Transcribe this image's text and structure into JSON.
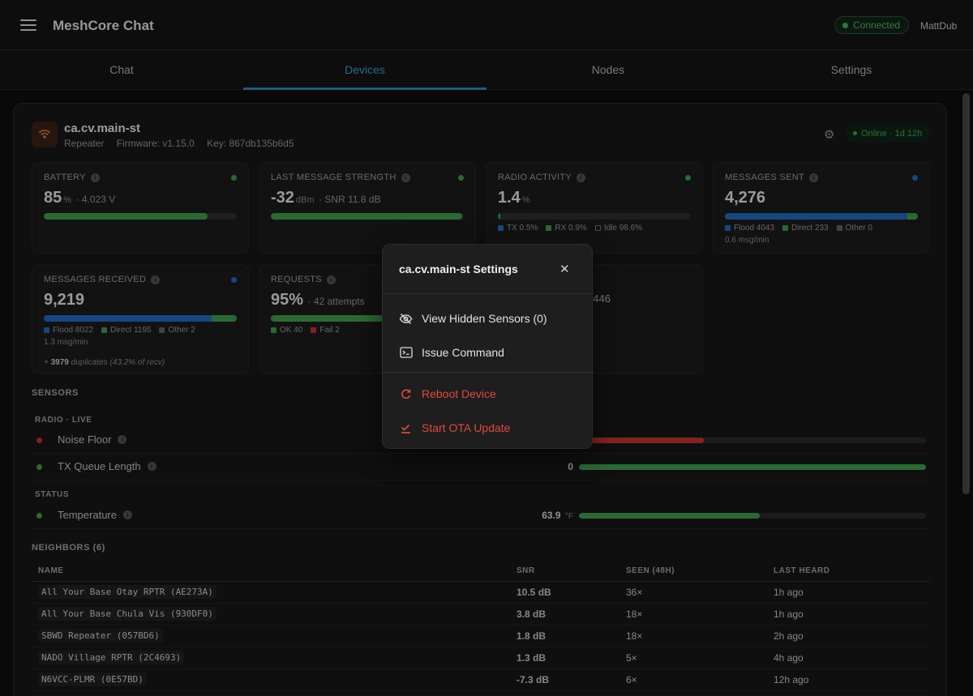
{
  "app": {
    "title": "MeshCore Chat",
    "user": "MattDub",
    "connection": "Connected"
  },
  "tabs": [
    {
      "label": "Chat"
    },
    {
      "label": "Devices"
    },
    {
      "label": "Nodes"
    },
    {
      "label": "Settings"
    }
  ],
  "device": {
    "name": "ca.cv.main-st",
    "role": "Repeater",
    "firmware": "Firmware: v1.15.0",
    "key": "Key: 867db135b6d5",
    "status": "Online · 1d 12h"
  },
  "cards": {
    "battery": {
      "label": "BATTERY",
      "value": "85",
      "unit": "%",
      "sub": "· 4.023 V",
      "level_pct": 85
    },
    "strength": {
      "label": "LAST MESSAGE STRENGTH",
      "value": "-32",
      "unit": "dBm",
      "sub": "· SNR 11.8 dB",
      "level_pct": 99
    },
    "radio": {
      "label": "RADIO ACTIVITY",
      "value": "1.4",
      "unit": "%",
      "tx": "TX 0.5%",
      "rx": "RX 0.9%",
      "idle": "Idle 98.6%",
      "tx_pct": 0.5,
      "rx_pct": 0.9
    },
    "sent": {
      "label": "MESSAGES SENT",
      "value": "4,276",
      "flood": "Flood 4043",
      "direct": "Direct 233",
      "other": "Other 0",
      "rate": "0.6 msg/min",
      "flood_n": 4043,
      "direct_n": 233,
      "other_n": 0
    },
    "received": {
      "label": "MESSAGES RECEIVED",
      "value": "9,219",
      "flood": "Flood 8022",
      "direct": "Direct 1195",
      "other": "Other 2",
      "rate": "1.3 msg/min",
      "dup_prefix": "+ ",
      "dup_count": "3979",
      "dup_suffix": " duplicates (43.2% of recv)",
      "flood_n": 8022,
      "direct_n": 1195,
      "other_n": 2
    },
    "requests": {
      "label": "REQUESTS",
      "value": "95%",
      "sub": "· 42 attempts",
      "ok": "OK 40",
      "fail": "Fail 2",
      "ok_n": 40,
      "fail_n": 2
    },
    "partial": {
      "text": "0446"
    }
  },
  "sensors": {
    "heading": "SENSORS",
    "radio_group": "RADIO · LIVE",
    "status_group": "STATUS",
    "rows": [
      {
        "name": "Noise Floor",
        "value": "",
        "unit": "",
        "level_pct": 36,
        "color": "#c9362c"
      },
      {
        "name": "TX Queue Length",
        "value": "0",
        "unit": "",
        "level_pct": 100,
        "color": "#3fa34d"
      },
      {
        "name": "Temperature",
        "value": "63.9",
        "unit": "°F",
        "level_pct": 52,
        "color": "#3fa34d"
      }
    ]
  },
  "neighbors": {
    "heading": "NEIGHBORS (6)",
    "columns": [
      "NAME",
      "SNR",
      "SEEN (48H)",
      "LAST HEARD"
    ],
    "rows": [
      [
        "All Your Base Otay RPTR (AE273A)",
        "10.5 dB",
        "36×",
        "1h ago"
      ],
      [
        "All Your Base Chula Vis (930DF0)",
        "3.8 dB",
        "18×",
        "1h ago"
      ],
      [
        "SBWD Repeater (057BD6)",
        "1.8 dB",
        "18×",
        "2h ago"
      ],
      [
        "NADO Village RPTR (2C4693)",
        "1.3 dB",
        "5×",
        "4h ago"
      ],
      [
        "N6VCC-PLMR (0E57BD)",
        "-7.3 dB",
        "6×",
        "12h ago"
      ]
    ]
  },
  "modal": {
    "title": "ca.cv.main-st Settings",
    "items": [
      {
        "label": "View Hidden Sensors (0)",
        "icon": "eye-off-icon"
      },
      {
        "label": "Issue Command",
        "icon": "terminal-icon"
      },
      {
        "label": "Reboot Device",
        "icon": "refresh-icon"
      },
      {
        "label": "Start OTA Update",
        "icon": "download-check-icon"
      }
    ]
  },
  "colors": {
    "accent": "#2b8ec4",
    "green": "#3fa34d",
    "red": "#c9362c",
    "blue": "#1f6fc4"
  }
}
